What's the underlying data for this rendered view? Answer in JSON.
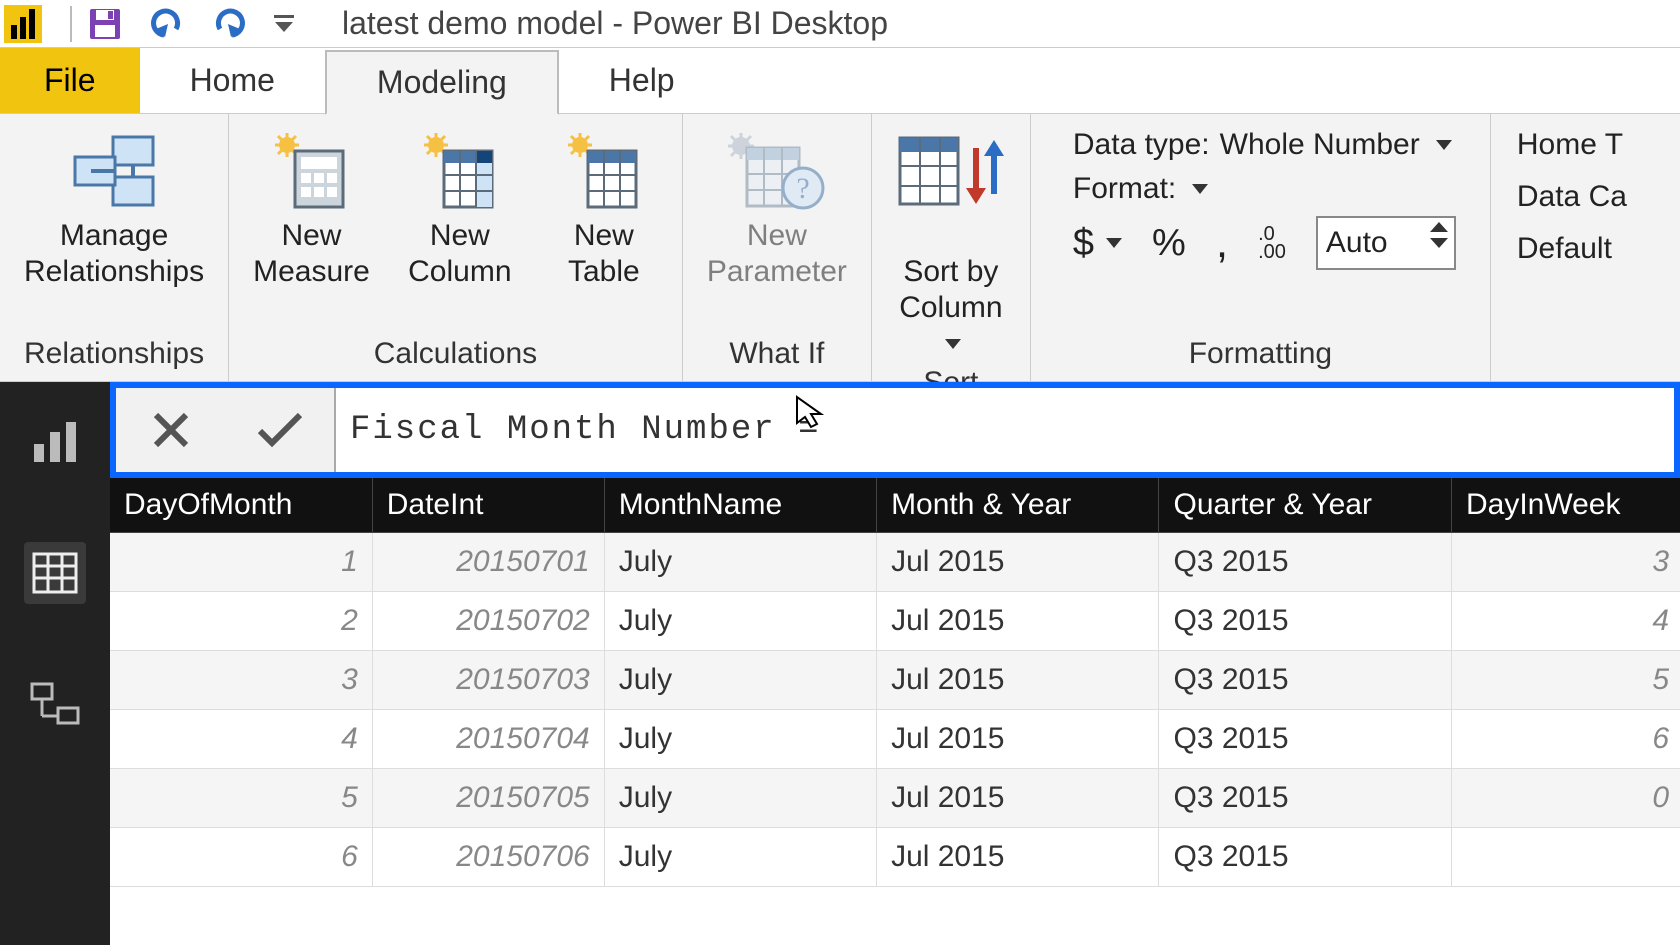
{
  "titlebar": {
    "title": "latest demo model - Power BI Desktop"
  },
  "tabs": {
    "file": "File",
    "home": "Home",
    "modeling": "Modeling",
    "help": "Help"
  },
  "ribbon": {
    "relationships": {
      "manage": "Manage\nRelationships",
      "group": "Relationships"
    },
    "calculations": {
      "measure": "New\nMeasure",
      "column": "New\nColumn",
      "table": "New\nTable",
      "group": "Calculations"
    },
    "whatif": {
      "parameter": "New\nParameter",
      "group": "What If"
    },
    "sort": {
      "sortby": "Sort by\nColumn",
      "group": "Sort"
    },
    "formatting": {
      "datatype_label": "Data type:",
      "datatype_value": "Whole Number",
      "format_label": "Format:",
      "currency": "$",
      "percent": "%",
      "thousands": ",",
      "decimals_icon": ".00",
      "decimals_value": "Auto",
      "group": "Formatting"
    },
    "properties": {
      "home_table": "Home T",
      "data_category": "Data Ca",
      "default": "Default"
    }
  },
  "formula": {
    "text": "Fiscal Month Number ="
  },
  "table": {
    "columns": [
      "DayOfMonth",
      "DateInt",
      "MonthName",
      "Month & Year",
      "Quarter & Year",
      "DayInWeek"
    ],
    "rows": [
      {
        "day": "1",
        "dateint": "20150701",
        "month": "July",
        "monthyear": "Jul 2015",
        "qyear": "Q3 2015",
        "diw": "3"
      },
      {
        "day": "2",
        "dateint": "20150702",
        "month": "July",
        "monthyear": "Jul 2015",
        "qyear": "Q3 2015",
        "diw": "4"
      },
      {
        "day": "3",
        "dateint": "20150703",
        "month": "July",
        "monthyear": "Jul 2015",
        "qyear": "Q3 2015",
        "diw": "5"
      },
      {
        "day": "4",
        "dateint": "20150704",
        "month": "July",
        "monthyear": "Jul 2015",
        "qyear": "Q3 2015",
        "diw": "6"
      },
      {
        "day": "5",
        "dateint": "20150705",
        "month": "July",
        "monthyear": "Jul 2015",
        "qyear": "Q3 2015",
        "diw": "0"
      },
      {
        "day": "6",
        "dateint": "20150706",
        "month": "July",
        "monthyear": "Jul 2015",
        "qyear": "Q3 2015",
        "diw": ""
      }
    ]
  }
}
